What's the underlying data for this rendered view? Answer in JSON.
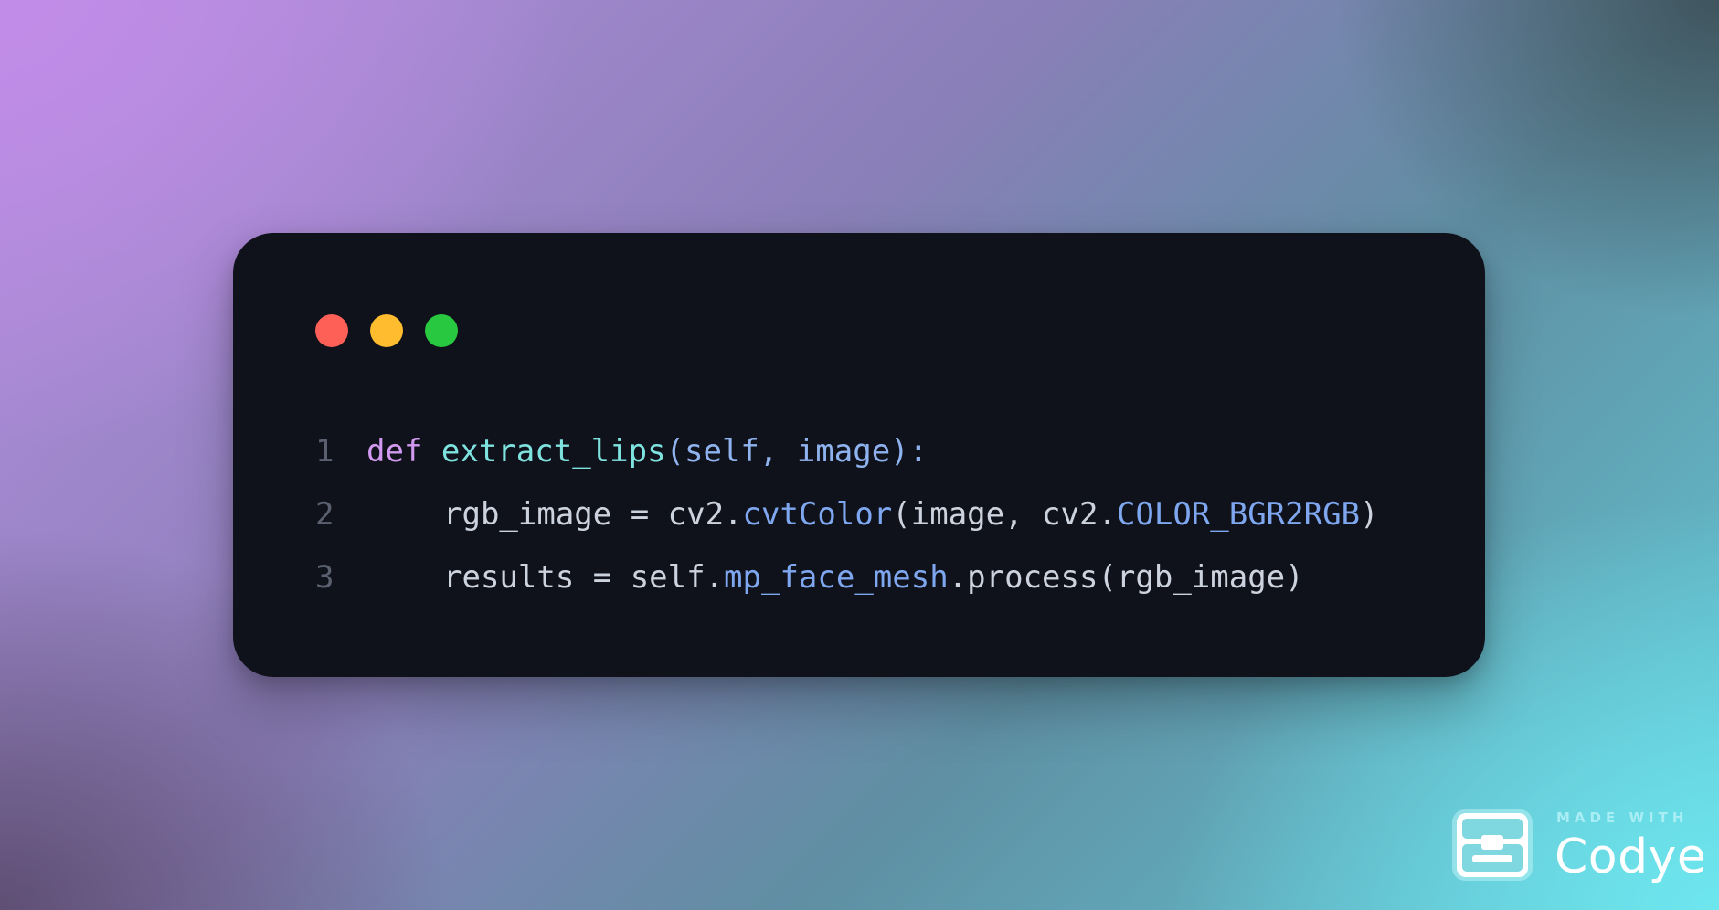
{
  "window": {
    "controls": [
      {
        "name": "close",
        "color": "#fe5f57"
      },
      {
        "name": "minimize",
        "color": "#febc2e"
      },
      {
        "name": "maximize",
        "color": "#28c840"
      }
    ]
  },
  "code": {
    "language": "python",
    "colors": {
      "keyword": "#d19af0",
      "function": "#7ee3df",
      "param": "#8fb3ef",
      "attribute": "#7ea7f0",
      "plain": "#cdd3de",
      "line_number": "#5a6070"
    },
    "lines": [
      {
        "number": "1",
        "indent": false,
        "tokens": [
          {
            "text": "def",
            "kind": "keyword"
          },
          {
            "text": " ",
            "kind": "plain"
          },
          {
            "text": "extract_lips",
            "kind": "function"
          },
          {
            "text": "(self, image):",
            "kind": "param"
          }
        ]
      },
      {
        "number": "2",
        "indent": true,
        "tokens": [
          {
            "text": "rgb_image = cv2.",
            "kind": "plain"
          },
          {
            "text": "cvtColor",
            "kind": "attribute"
          },
          {
            "text": "(image, cv2.",
            "kind": "plain"
          },
          {
            "text": "COLOR_BGR2RGB",
            "kind": "attribute"
          },
          {
            "text": ")",
            "kind": "plain"
          }
        ]
      },
      {
        "number": "3",
        "indent": true,
        "tokens": [
          {
            "text": "results = self.",
            "kind": "plain"
          },
          {
            "text": "mp_face_mesh",
            "kind": "attribute"
          },
          {
            "text": ".process(rgb_image)",
            "kind": "plain"
          }
        ]
      }
    ]
  },
  "badge": {
    "small_text": "MADE WITH",
    "brand": "Codye",
    "icon": "codye-logo-icon"
  }
}
